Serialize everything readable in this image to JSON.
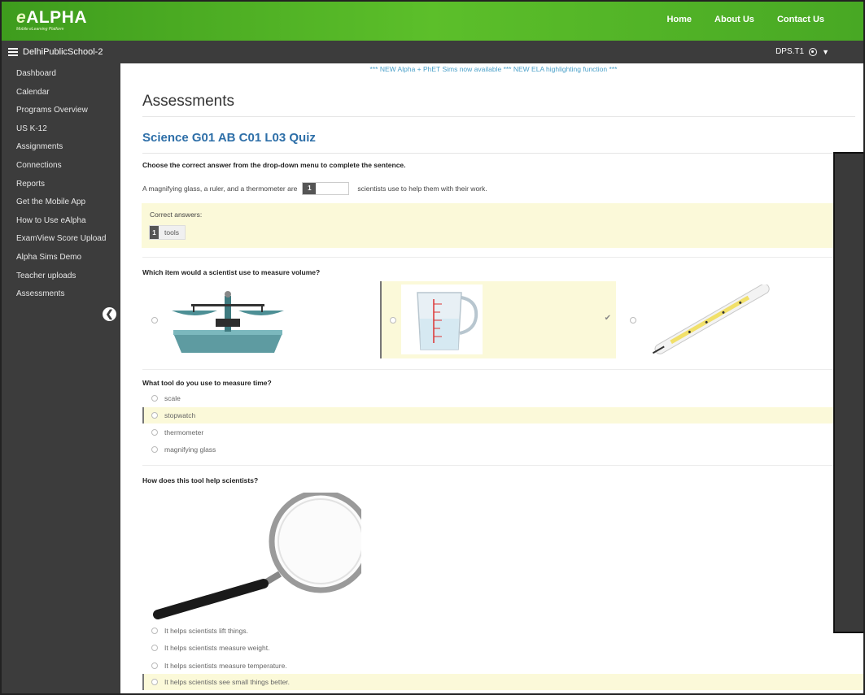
{
  "header": {
    "brand": "ALPHA",
    "brand_prefix": "e",
    "tagline": "Mobile eLearning Platform",
    "nav": [
      "Home",
      "About Us",
      "Contact Us"
    ]
  },
  "subbar": {
    "school": "DelhiPublicSchool-2",
    "user": "DPS.T1"
  },
  "sidebar": {
    "items": [
      "Dashboard",
      "Calendar",
      "Programs Overview",
      "US K-12",
      "Assignments",
      "Connections",
      "Reports",
      "Get the Mobile App",
      "How to Use eAlpha",
      "ExamView Score Upload",
      "Alpha Sims Demo",
      "Teacher uploads",
      "Assessments"
    ]
  },
  "main": {
    "announcement": "*** NEW Alpha + PhET Sims now available *** NEW ELA highlighting function ***",
    "page_title": "Assessments",
    "quiz_title": "Science G01 AB C01 L03 Quiz",
    "q1": {
      "prompt": "Choose the correct answer from the drop-down menu to complete the sentence.",
      "sentence_before": "A magnifying glass, a ruler, and a thermometer are",
      "blank_number": "1",
      "sentence_after": "scientists use to help them with their work.",
      "correct_label": "Correct answers:",
      "correct_number": "1",
      "correct_value": "tools"
    },
    "q2": {
      "prompt": "Which item would a scientist use to measure volume?",
      "selected_index": 1
    },
    "q3": {
      "prompt": "What tool do you use to measure time?",
      "options": [
        "scale",
        "stopwatch",
        "thermometer",
        "magnifying glass"
      ],
      "selected_index": 1
    },
    "q4": {
      "prompt": "How does this tool help scientists?",
      "options": [
        "It helps scientists lift things.",
        "It helps scientists measure weight.",
        "It helps scientists measure temperature.",
        "It helps scientists see small things better."
      ],
      "selected_index": 3
    }
  },
  "colors": {
    "brand_green": "#5cbf2a",
    "sidebar": "#3c3c3c",
    "quiz_title": "#2e6fa8",
    "highlight": "#fbf9d9"
  },
  "icons": {
    "menu": "hamburger-icon",
    "user": "user-circle-icon",
    "collapse": "chevron-left-icon",
    "check": "check-icon"
  }
}
